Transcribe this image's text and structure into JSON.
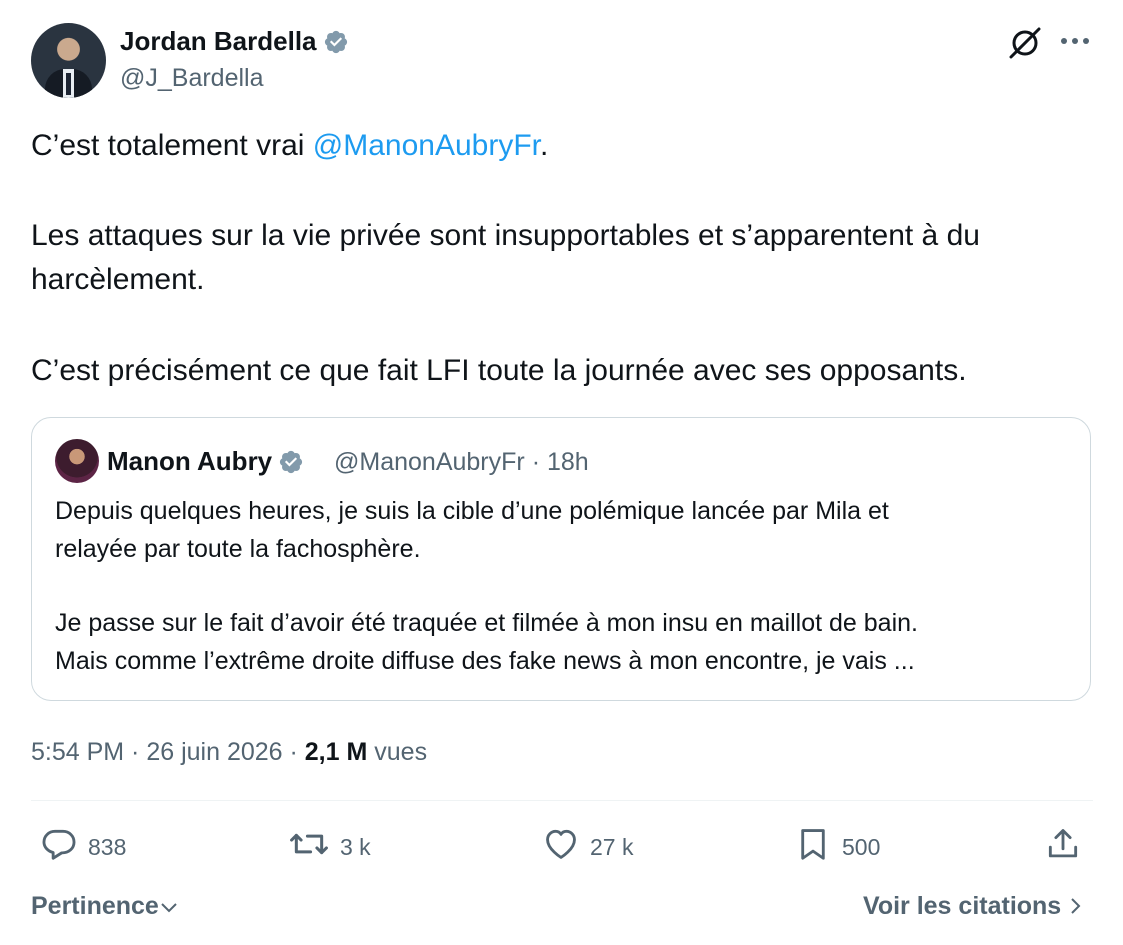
{
  "author": {
    "name": "Jordan Bardella",
    "handle": "@J_Bardella",
    "verified": true
  },
  "tweet": {
    "line1_prefix": "C’est totalement vrai ",
    "line1_mention": "@ManonAubryFr",
    "line1_suffix": ".",
    "para2_line1": "Les attaques sur la vie privée sont insupportables et s’apparentent à du",
    "para2_line2": "harcèlement.",
    "para3": "C’est précisément ce que fait LFI toute la journée avec ses opposants."
  },
  "quoted": {
    "name": "Manon Aubry",
    "handle": "@ManonAubryFr",
    "separator": "·",
    "time": "18h",
    "line1": "Depuis quelques heures, je suis la cible d’une polémique lancée par Mila et",
    "line2": "relayée par toute la fachosphère.",
    "line3": "Je passe sur le fait d’avoir été traquée et filmée à mon insu en maillot de bain.",
    "line4": "Mais comme l’extrême droite diffuse des fake news à mon encontre, je vais ..."
  },
  "meta": {
    "time": "5:54 PM",
    "date": "26 juin 2026",
    "views_count": "2,1 M",
    "views_label": "vues"
  },
  "actions": {
    "replies": "838",
    "reposts": "3 k",
    "likes": "27 k",
    "bookmarks": "500"
  },
  "footer": {
    "sort_label": "Pertinence",
    "quotes_link": "Voir les citations"
  },
  "colors": {
    "accent": "#1d9bf0",
    "text": "#0f1419",
    "secondary": "#536471",
    "border": "#cfd9de"
  },
  "icons": [
    "verified-badge-icon",
    "grok-icon",
    "more-icon",
    "reply-icon",
    "repost-icon",
    "like-icon",
    "bookmark-icon",
    "share-icon",
    "chevron-down-icon",
    "chevron-right-icon"
  ]
}
